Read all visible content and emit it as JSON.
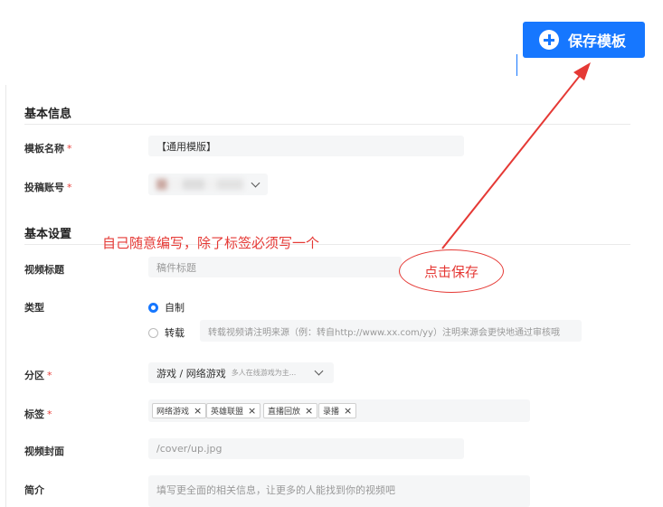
{
  "toolbar": {
    "save_label": "保存模板"
  },
  "sections": {
    "basic_info": "基本信息",
    "basic_settings": "基本设置"
  },
  "form": {
    "template_name": {
      "label": "模板名称",
      "required": "*",
      "value": "【通用模版】"
    },
    "account": {
      "label": "投稿账号",
      "required": "*"
    },
    "title": {
      "label": "视频标题",
      "placeholder": "稿件标题"
    },
    "type": {
      "label": "类型",
      "option_self": "自制",
      "option_repost": "转载",
      "repost_placeholder": "转载视频请注明来源（例：转自http://www.xx.com/yy）注明来源会更快地通过审核哦"
    },
    "zone": {
      "label": "分区",
      "required": "*",
      "value": "游戏 / 网络游戏",
      "hint": "多人在线游戏为主..."
    },
    "tags": {
      "label": "标签",
      "required": "*",
      "items": [
        "网络游戏",
        "英雄联盟",
        "直播回放",
        "录播"
      ],
      "remove_glyph": "×"
    },
    "cover": {
      "label": "视频封面",
      "value": "/cover/up.jpg"
    },
    "intro": {
      "label": "简介",
      "placeholder": "填写更全面的相关信息，让更多的人能找到你的视频吧"
    }
  },
  "annotations": {
    "note": "自己随意编写，除了标签必须写一个",
    "click_save": "点击保存",
    "color": "#e53935"
  },
  "colors": {
    "accent": "#1677ff",
    "required": "#e8413b"
  }
}
